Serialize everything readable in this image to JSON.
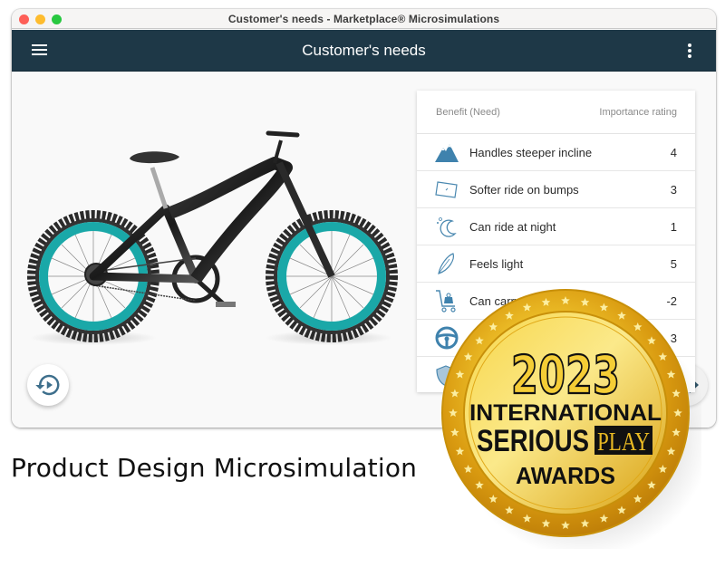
{
  "window": {
    "title": "Customer's needs - Marketplace® Microsimulations",
    "traffic_lights": [
      "close",
      "minimize",
      "maximize"
    ]
  },
  "appbar": {
    "title": "Customer's needs",
    "menu_icon": "hamburger-menu-icon",
    "more_icon": "more-vertical-icon"
  },
  "product": {
    "image": "mountain-bike-image",
    "accent_color": "#1aa8a8"
  },
  "needs_table": {
    "header": {
      "benefit": "Benefit (Need)",
      "importance": "Importance rating"
    },
    "rows": [
      {
        "icon": "mountain-icon",
        "label": "Handles steeper incline",
        "rating": "4"
      },
      {
        "icon": "pillow-icon",
        "label": "Softer ride on bumps",
        "rating": "3"
      },
      {
        "icon": "moon-stars-icon",
        "label": "Can ride at night",
        "rating": "1"
      },
      {
        "icon": "feather-icon",
        "label": "Feels light",
        "rating": "5"
      },
      {
        "icon": "cart-icon",
        "label": "Can carry",
        "rating": "-2"
      },
      {
        "icon": "steering-wheel-icon",
        "label": "",
        "rating": "3"
      },
      {
        "icon": "shield-icon",
        "label": "",
        "rating": ""
      }
    ]
  },
  "buttons": {
    "replay": "replay-icon",
    "next": "chevron-right-icon"
  },
  "caption": "Product Design Microsimulation",
  "award": {
    "year": "2023",
    "line1": "INTERNATIONAL",
    "line2a": "SERIOUS",
    "line2b": "PLAY",
    "line3": "AWARDS"
  },
  "colors": {
    "appbar": "#1e3847",
    "icon_blue": "#4a88b0",
    "gold": "#e8b923"
  }
}
